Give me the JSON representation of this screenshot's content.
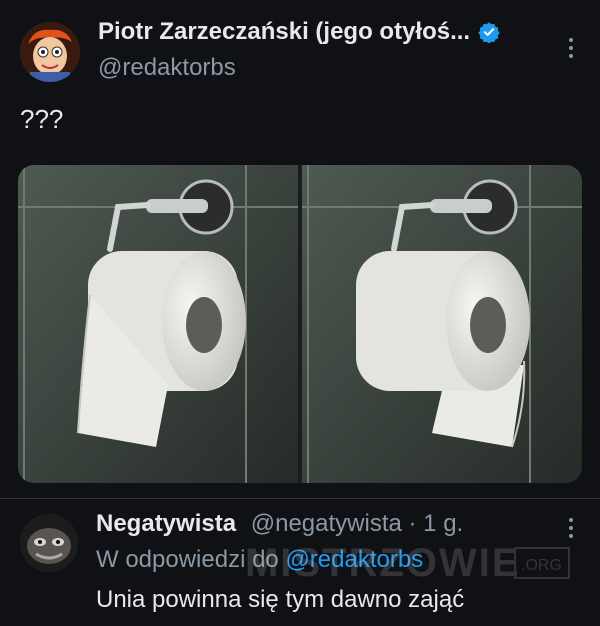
{
  "tweet": {
    "display_name": "Piotr Zarzeczański (jego otyłoś...",
    "handle": "@redaktorbs",
    "text": "???",
    "verified_icon": "verified-badge-icon",
    "more_icon": "more-options-icon"
  },
  "media": {
    "images": [
      {
        "name": "toilet-paper-under-photo"
      },
      {
        "name": "toilet-paper-over-photo"
      }
    ]
  },
  "reply": {
    "display_name": "Negatywista",
    "handle": "@negatywista",
    "separator": " · ",
    "time": "1 g.",
    "reply_prefix": "W odpowiedzi do ",
    "reply_mention": "@redaktorbs",
    "text": "Unia powinna się tym dawno zająć"
  },
  "watermark": {
    "text": "Mistrzowie.org"
  },
  "colors": {
    "background": "#0f1114",
    "primary_text": "#e7e9ea",
    "secondary_text": "#8b98a5",
    "accent": "#1d9bf0"
  }
}
